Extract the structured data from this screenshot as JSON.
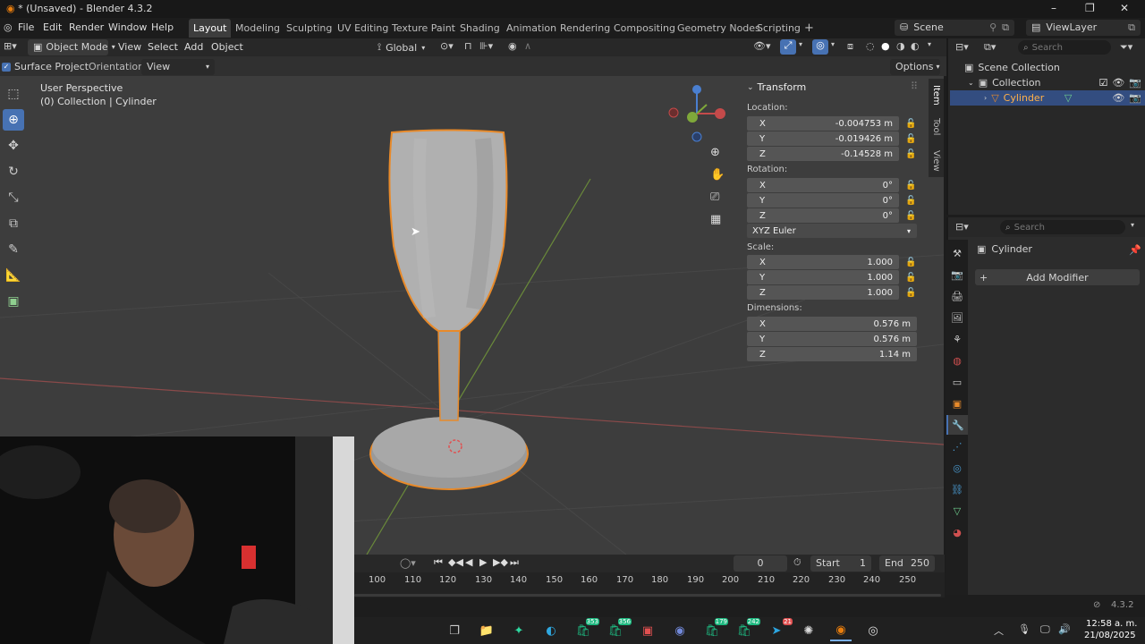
{
  "window": {
    "title": "* (Unsaved) - Blender 4.3.2",
    "minimize": "–",
    "maximize": "❐",
    "close": "✕"
  },
  "menu": [
    "File",
    "Edit",
    "Render",
    "Window",
    "Help"
  ],
  "workspaces": [
    "Layout",
    "Modeling",
    "Sculpting",
    "UV Editing",
    "Texture Paint",
    "Shading",
    "Animation",
    "Rendering",
    "Compositing",
    "Geometry Nodes",
    "Scripting"
  ],
  "add_workspace": "+",
  "scene": {
    "label": "Scene",
    "viewlayer": "ViewLayer"
  },
  "header": {
    "mode": "Object Mode",
    "menus": [
      "View",
      "Select",
      "Add",
      "Object"
    ],
    "orientation": "Global"
  },
  "tool_settings": {
    "surface_project": "Surface Project",
    "orientation_label": "Orientation:",
    "orientation_value": "View",
    "options": "Options"
  },
  "viewport": {
    "perspective": "User Perspective",
    "collection_info": "(0) Collection | Cylinder"
  },
  "n_tabs": [
    "Item",
    "Tool",
    "View"
  ],
  "transform": {
    "title": "Transform",
    "location_label": "Location:",
    "location": [
      {
        "axis": "X",
        "value": "-0.004753 m"
      },
      {
        "axis": "Y",
        "value": "-0.019426 m"
      },
      {
        "axis": "Z",
        "value": "-0.14528 m"
      }
    ],
    "rotation_label": "Rotation:",
    "rotation": [
      {
        "axis": "X",
        "value": "0°"
      },
      {
        "axis": "Y",
        "value": "0°"
      },
      {
        "axis": "Z",
        "value": "0°"
      }
    ],
    "rotation_mode": "XYZ Euler",
    "scale_label": "Scale:",
    "scale": [
      {
        "axis": "X",
        "value": "1.000"
      },
      {
        "axis": "Y",
        "value": "1.000"
      },
      {
        "axis": "Z",
        "value": "1.000"
      }
    ],
    "dimensions_label": "Dimensions:",
    "dimensions": [
      {
        "axis": "X",
        "value": "0.576 m"
      },
      {
        "axis": "Y",
        "value": "0.576 m"
      },
      {
        "axis": "Z",
        "value": "1.14 m"
      }
    ]
  },
  "outliner": {
    "search_placeholder": "Search",
    "items": [
      "Scene Collection",
      "Collection",
      "Cylinder"
    ]
  },
  "properties": {
    "search_placeholder": "Search",
    "object": "Cylinder",
    "add_modifier": "Add Modifier"
  },
  "timeline": {
    "current_frame": "0",
    "start_label": "Start",
    "start": "1",
    "end_label": "End",
    "end": "250",
    "ticks": [
      "100",
      "110",
      "120",
      "130",
      "140",
      "150",
      "160",
      "170",
      "180",
      "190",
      "200",
      "210",
      "220",
      "230",
      "240",
      "250"
    ]
  },
  "status": {
    "version": "4.3.2"
  },
  "taskbar": {
    "time": "12:58 a. m.",
    "date": "21/08/2025",
    "badges": [
      "353",
      "356",
      "179",
      "242",
      "21"
    ]
  },
  "colors": {
    "accent": "#4772b3",
    "selection": "#e88a2a",
    "viewport": "#3d3d3d",
    "x_axis": "#c44a4a",
    "y_axis": "#7fa83a",
    "z_axis": "#4a7fd0"
  }
}
